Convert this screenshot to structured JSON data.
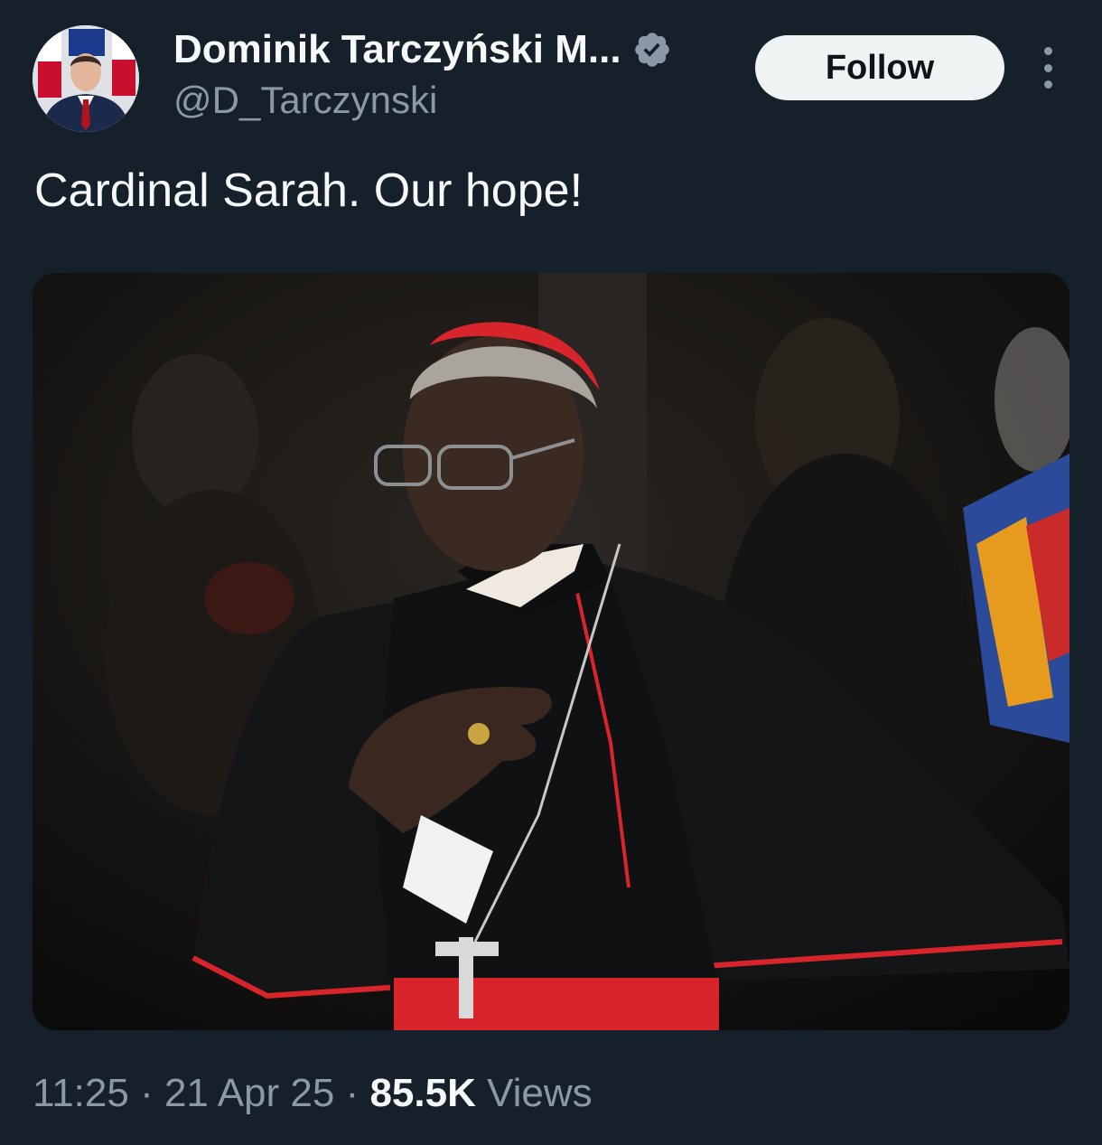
{
  "author": {
    "display_name": "Dominik Tarczyński M...",
    "handle": "@D_Tarczynski",
    "verified_badge_icon": "verified-badge-icon",
    "verified_color": "#8b98a5"
  },
  "actions": {
    "follow_label": "Follow",
    "more_icon": "more-dots-icon"
  },
  "tweet": {
    "text": "Cardinal Sarah. Our hope!"
  },
  "meta": {
    "time": "11:25",
    "sep1": " · ",
    "date": "21 Apr 25",
    "sep2": " · ",
    "views_count": "85.5K",
    "views_label": " Views"
  },
  "colors": {
    "background": "#15202b",
    "primary_text": "#f7f9f9",
    "secondary_text": "#8b98a5",
    "follow_bg": "#eff3f4",
    "cardinal_red": "#d8242b"
  }
}
